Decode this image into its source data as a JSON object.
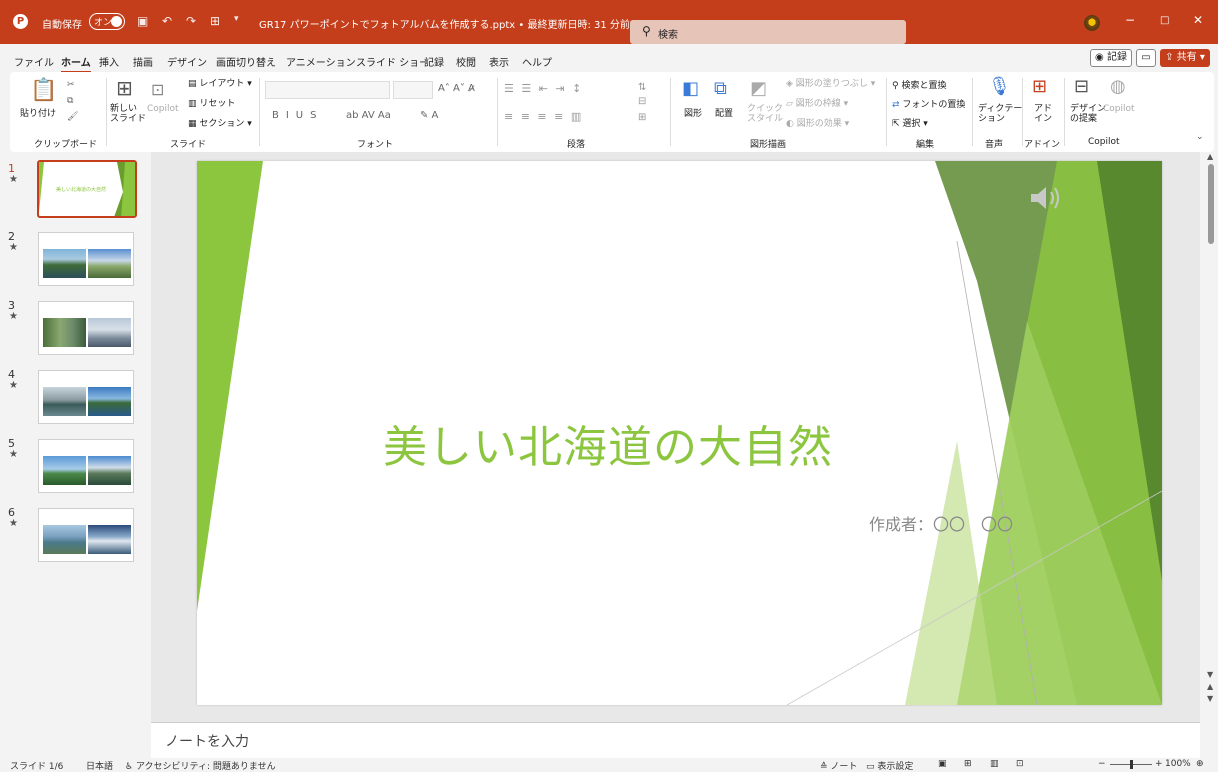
{
  "titlebar": {
    "autosave_label": "自動保存",
    "autosave_state": "オン",
    "doc_title": "GR17 パワーポイントでフォトアルバムを作成する.pptx • 最終更新日時: 31 分前 ∨",
    "search_placeholder": "検索",
    "minimize": "−",
    "maximize": "□",
    "close": "✕"
  },
  "menu": {
    "tabs": [
      "ファイル",
      "ホーム",
      "挿入",
      "描画",
      "デザイン",
      "画面切り替え",
      "アニメーション",
      "スライド ショー",
      "記録",
      "校閲",
      "表示",
      "ヘルプ"
    ],
    "record": "◉ 記録",
    "share": "共有"
  },
  "ribbon": {
    "clipboard": {
      "paste": "貼り付け",
      "group": "クリップボード"
    },
    "slides": {
      "new_slide": "新しい\nスライド",
      "copilot": "Copilot",
      "layout": "レイアウト",
      "reset": "リセット",
      "section": "セクション",
      "group": "スライド"
    },
    "font": {
      "group": "フォント"
    },
    "paragraph": {
      "group": "段落"
    },
    "drawing": {
      "shapes": "図形",
      "arrange": "配置",
      "quick_style": "クイック\nスタイル",
      "fill": "図形の塗りつぶし",
      "outline": "図形の枠線",
      "effects": "図形の効果",
      "group": "図形描画"
    },
    "editing": {
      "find_replace": "検索と置換",
      "replace_font": "フォントの置換",
      "select": "選択",
      "group": "編集"
    },
    "voice": {
      "dictate": "ディクテー\nション",
      "group": "音声"
    },
    "addins": {
      "addin": "アド\nイン",
      "group": "アドイン"
    },
    "copilot": {
      "design": "デザイン\nの提案",
      "copilot": "Copilot",
      "group": "Copilot"
    }
  },
  "thumbnails": [
    {
      "num": "1",
      "title": "美しい北海道の大自然"
    },
    {
      "num": "2"
    },
    {
      "num": "3"
    },
    {
      "num": "4"
    },
    {
      "num": "5"
    },
    {
      "num": "6"
    }
  ],
  "slide": {
    "title": "美しい北海道の大自然",
    "subtitle": "作成者：〇〇　〇〇"
  },
  "notes": {
    "placeholder": "ノートを入力"
  },
  "status": {
    "slide_count": "スライド 1/6",
    "language": "日本語",
    "accessibility": "アクセシビリティ: 問題ありません",
    "notes": "ノート",
    "display_settings": "表示設定",
    "zoom": "100%"
  },
  "colors": {
    "accent": "#c43e1c",
    "title_green": "#8cc63f"
  }
}
